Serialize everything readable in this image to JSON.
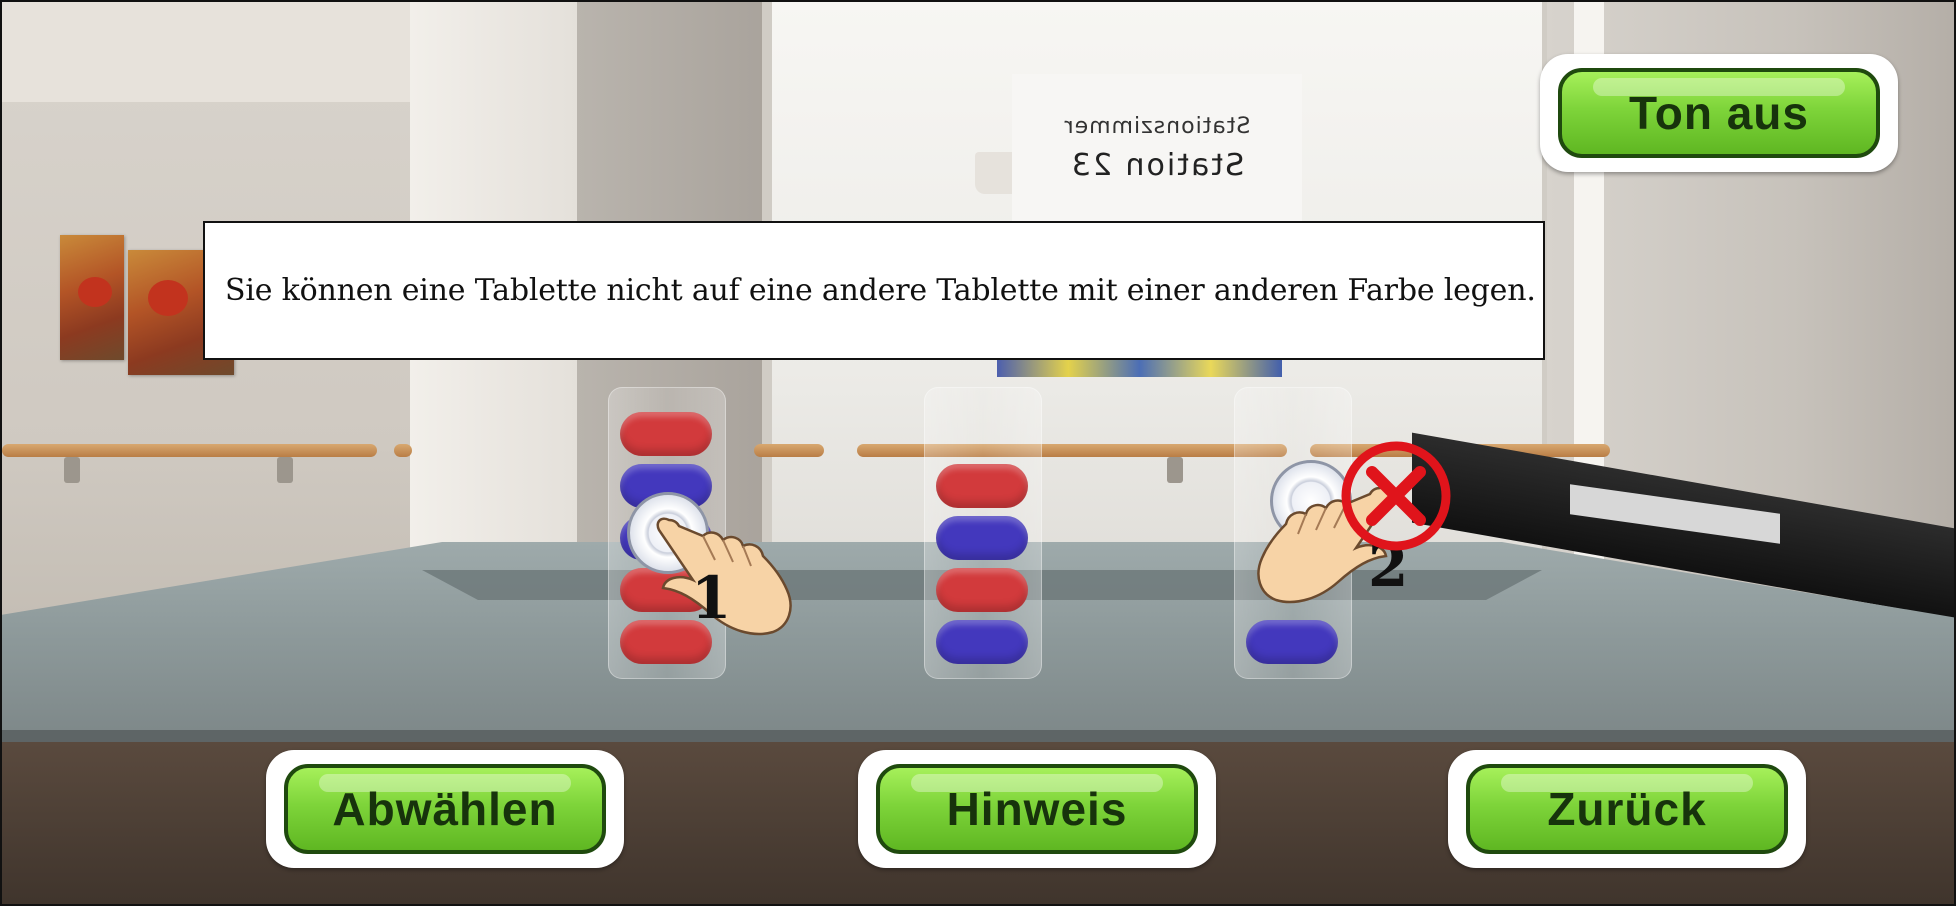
{
  "scene": {
    "sign_line1": "Stationszimmer",
    "sign_line2": "Station 23"
  },
  "message": {
    "text": "Sie können eine Tablette nicht auf eine andere Tablette mit einer anderen Farbe legen."
  },
  "buttons": {
    "sound": "Ton aus",
    "deselect": "Abwählen",
    "hint": "Hinweis",
    "back": "Zurück"
  },
  "tubes": [
    {
      "pills": [
        "red",
        "blue",
        "blue",
        "red",
        "red"
      ]
    },
    {
      "pills": [
        "red",
        "blue",
        "red",
        "blue"
      ]
    },
    {
      "pills": [
        "blue"
      ]
    }
  ],
  "steps": {
    "step1": "1",
    "step2": "2"
  },
  "colors": {
    "pill_red": "#d23a3c",
    "pill_blue": "#4338bd",
    "button_green": "#7ed43a",
    "button_border": "#1f4a0e",
    "error_red": "#e0141b"
  }
}
